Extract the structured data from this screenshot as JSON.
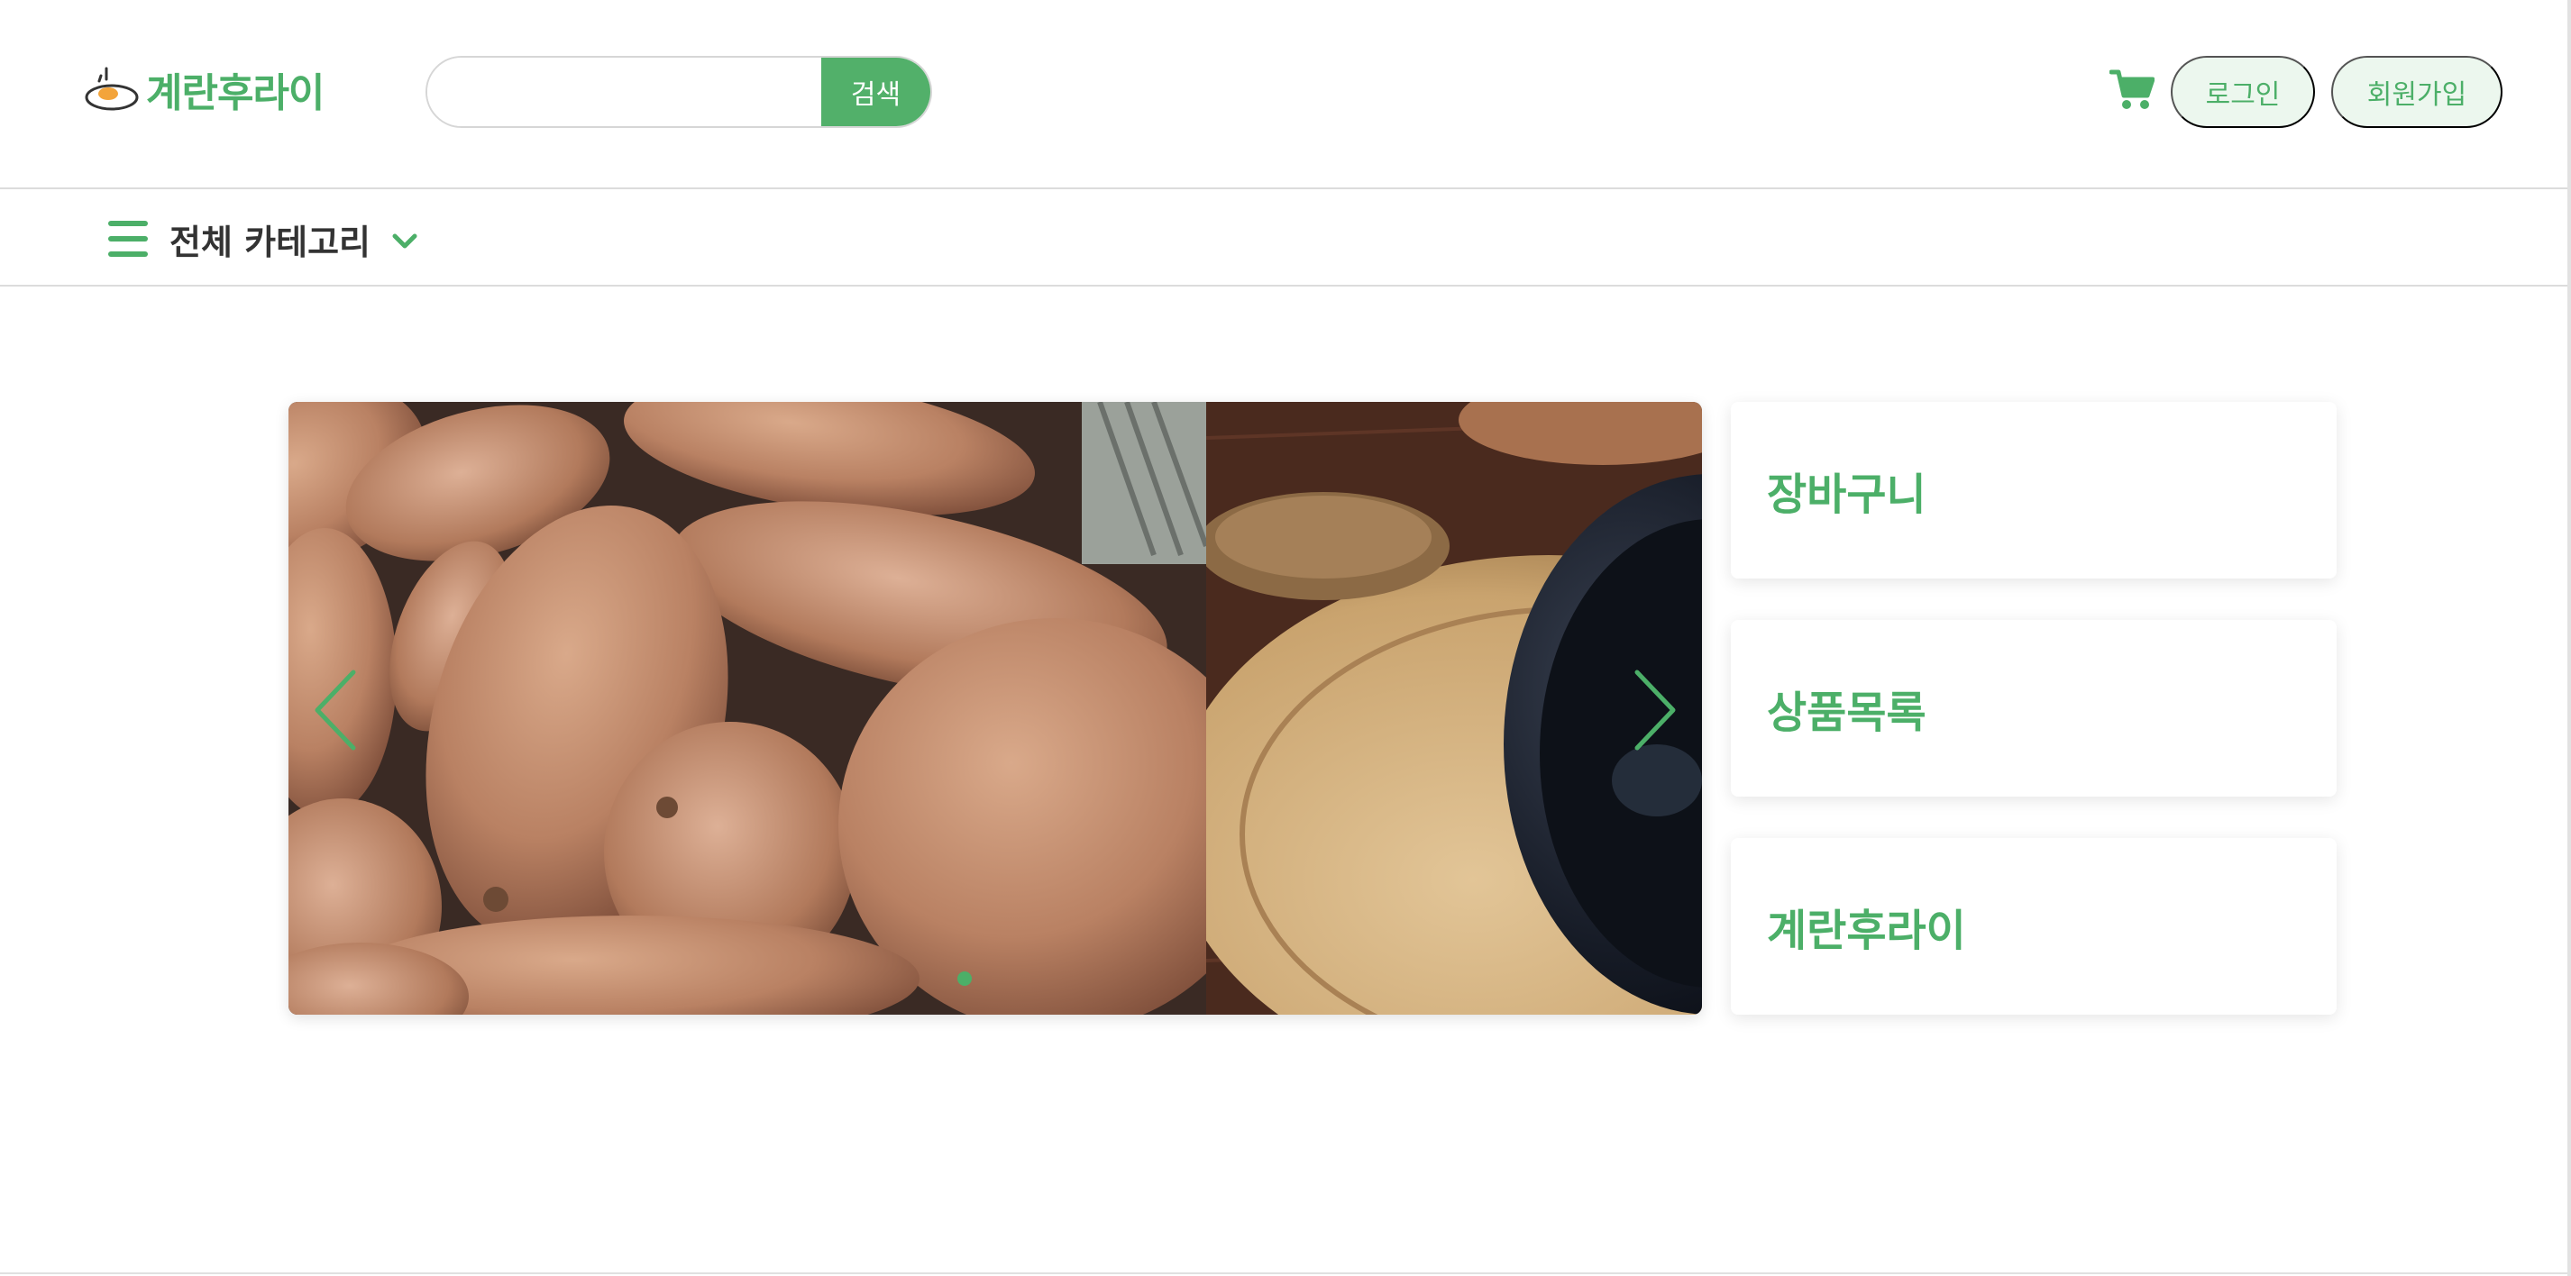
{
  "header": {
    "logo_text": "계란후라이",
    "search": {
      "value": "",
      "placeholder": "",
      "button_label": "검색"
    },
    "cart_icon": "shopping-cart-icon",
    "login_label": "로그인",
    "signup_label": "회원가입"
  },
  "category_nav": {
    "label": "전체 카테고리",
    "menu_icon": "hamburger-menu-icon",
    "dropdown_icon": "chevron-down-icon"
  },
  "carousel": {
    "slides": [
      "sweet-potatoes-photo",
      "wooden-board-bowl-photo"
    ],
    "active_index": 0,
    "prev_icon": "chevron-left-icon",
    "next_icon": "chevron-right-icon"
  },
  "side_cards": [
    {
      "label": "장바구니"
    },
    {
      "label": "상품목록"
    },
    {
      "label": "계란후라이"
    }
  ],
  "colors": {
    "accent": "#4caf68",
    "accent_light": "#ecf7ee",
    "border": "#dcdcdc",
    "text_dark": "#333333"
  }
}
